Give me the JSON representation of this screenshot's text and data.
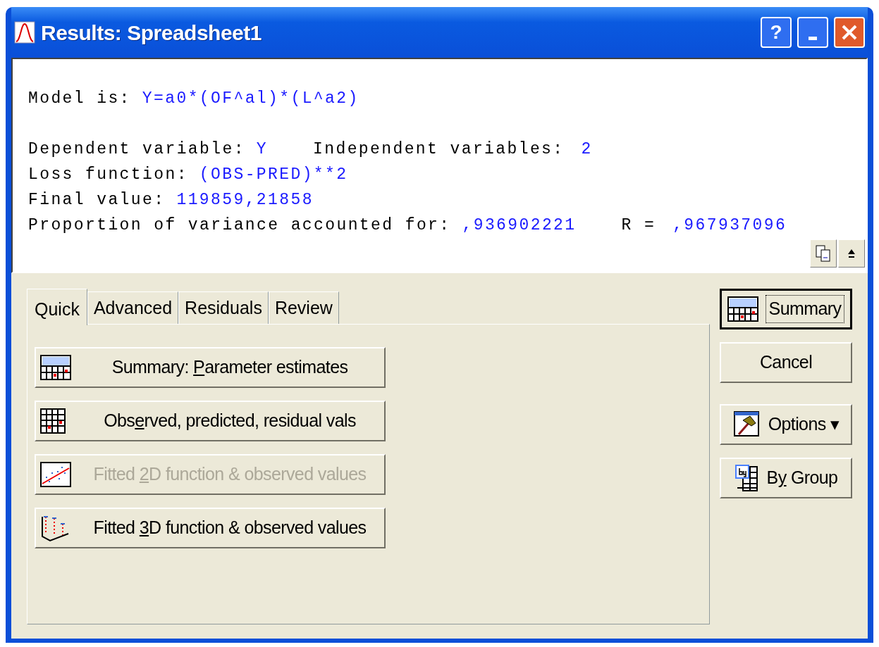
{
  "window": {
    "title": "Results: Spreadsheet1"
  },
  "title_buttons": [
    {
      "kind": "help",
      "label": "?"
    },
    {
      "kind": "minimize"
    },
    {
      "kind": "close"
    }
  ],
  "output": {
    "lines": [
      [
        {
          "kind": "label",
          "text": "Model is:"
        },
        {
          "kind": "value",
          "text": "Y=a0*(OF^al)*(L^a2)"
        }
      ],
      [
        {
          "kind": "label",
          "text": "Dependent variable:"
        },
        {
          "kind": "value",
          "text": "Y"
        },
        {
          "kind": "label",
          "text": "Independent variables:"
        },
        {
          "kind": "value",
          "text": "2"
        }
      ],
      [
        {
          "kind": "label",
          "text": "Loss function:"
        },
        {
          "kind": "value",
          "text": "(OBS-PRED)**2"
        }
      ],
      [
        {
          "kind": "label",
          "text": "Final value:"
        },
        {
          "kind": "value",
          "text": "119859,21858"
        }
      ],
      [
        {
          "kind": "label",
          "text": "Proportion of variance accounted for:"
        },
        {
          "kind": "value",
          "text": ",936902221"
        },
        {
          "kind": "label",
          "text": "R ="
        },
        {
          "kind": "value",
          "text": ",967937096"
        }
      ]
    ]
  },
  "tabs": [
    {
      "label": "Quick",
      "selected": true
    },
    {
      "label": "Advanced",
      "selected": false
    },
    {
      "label": "Residuals",
      "selected": false
    },
    {
      "label": "Review",
      "selected": false
    }
  ],
  "actions": [
    {
      "before": "Summary: ",
      "key": "P",
      "after": "arameter estimates",
      "disabled": false
    },
    {
      "before": "Obs",
      "key": "e",
      "after": "rved, predicted, residual vals",
      "disabled": false
    },
    {
      "before": "Fitted ",
      "key": "2",
      "after": "D function & observed values",
      "disabled": true
    },
    {
      "before": "Fitted ",
      "key": "3",
      "after": "D function & observed values",
      "disabled": false
    }
  ],
  "side_buttons": [
    {
      "before": "Summary",
      "default": true
    },
    {
      "before": "Cancel",
      "default": false
    },
    {
      "before": "Options ▾",
      "default": false
    },
    {
      "before": "B",
      "key": "y",
      "after": " Group",
      "default": false
    }
  ]
}
